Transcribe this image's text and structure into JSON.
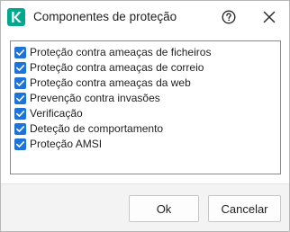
{
  "window": {
    "title": "Componentes de proteção",
    "logo_color": "#00a88e",
    "logo_icon": "kaspersky-k-logo",
    "help_icon": "help-circle-icon",
    "close_icon": "close-icon"
  },
  "components": {
    "checkbox_color": "#1e73d9",
    "items": [
      {
        "label": "Proteção contra ameaças de ficheiros",
        "checked": true
      },
      {
        "label": "Proteção contra ameaças de correio",
        "checked": true
      },
      {
        "label": "Proteção contra ameaças da web",
        "checked": true
      },
      {
        "label": "Prevenção contra invasões",
        "checked": true
      },
      {
        "label": "Verificação",
        "checked": true
      },
      {
        "label": "Deteção de comportamento",
        "checked": true
      },
      {
        "label": "Proteção AMSI",
        "checked": true
      }
    ]
  },
  "footer": {
    "ok_label": "Ok",
    "cancel_label": "Cancelar"
  }
}
